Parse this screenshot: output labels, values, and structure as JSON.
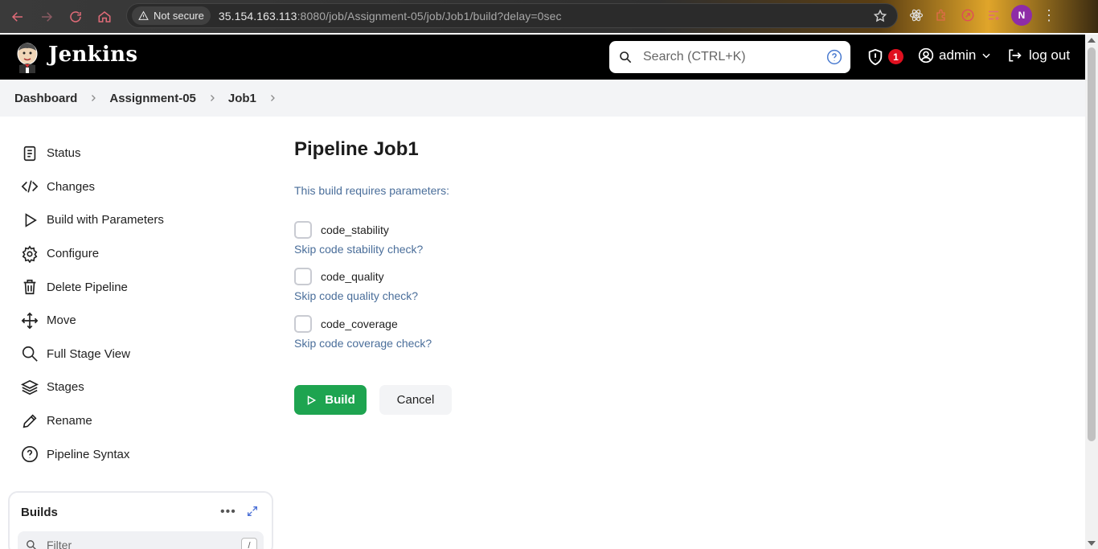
{
  "browser": {
    "security_label": "Not secure",
    "url_host": "35.154.163.113",
    "url_rest": ":8080/job/Assignment-05/job/Job1/build?delay=0sec",
    "profile_initial": "N"
  },
  "header": {
    "brand": "Jenkins",
    "search_placeholder": "Search (CTRL+K)",
    "security_badge_count": "1",
    "user_name": "admin",
    "logout_label": "log out"
  },
  "breadcrumb": [
    "Dashboard",
    "Assignment-05",
    "Job1"
  ],
  "sidebar": {
    "items": [
      {
        "label": "Status",
        "icon": "document-icon"
      },
      {
        "label": "Changes",
        "icon": "code-icon"
      },
      {
        "label": "Build with Parameters",
        "icon": "play-icon"
      },
      {
        "label": "Configure",
        "icon": "gear-icon"
      },
      {
        "label": "Delete Pipeline",
        "icon": "trash-icon"
      },
      {
        "label": "Move",
        "icon": "move-icon"
      },
      {
        "label": "Full Stage View",
        "icon": "search-icon"
      },
      {
        "label": "Stages",
        "icon": "layers-icon"
      },
      {
        "label": "Rename",
        "icon": "pencil-icon"
      },
      {
        "label": "Pipeline Syntax",
        "icon": "help-circle-icon"
      }
    ],
    "builds_title": "Builds",
    "filter_placeholder": "Filter",
    "filter_shortcut": "/"
  },
  "main": {
    "title": "Pipeline Job1",
    "requires_text": "This build requires parameters:",
    "params": [
      {
        "name": "code_stability",
        "description": "Skip code stability check?",
        "checked": false
      },
      {
        "name": "code_quality",
        "description": "Skip code quality check?",
        "checked": false
      },
      {
        "name": "code_coverage",
        "description": "Skip code coverage check?",
        "checked": false
      }
    ],
    "build_label": "Build",
    "cancel_label": "Cancel"
  },
  "colors": {
    "build_button": "#1ea450",
    "link_text": "#4a6e9a",
    "header_bg": "#000000",
    "badge": "#e0101f"
  }
}
